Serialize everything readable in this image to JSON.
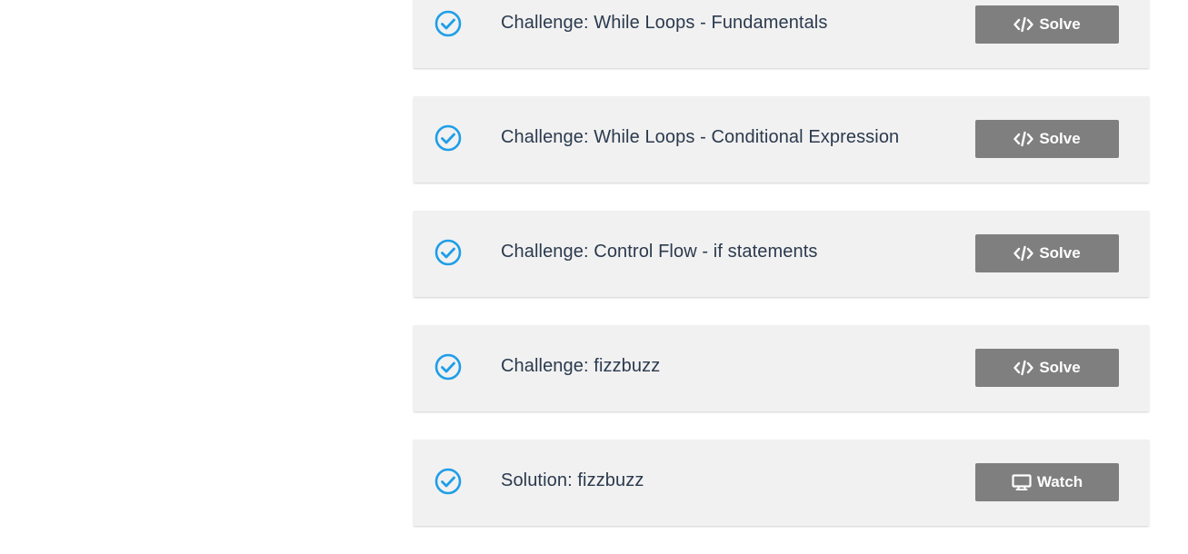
{
  "lessons": [
    {
      "title": "Challenge: While Loops - Fundamentals",
      "status_icon": "check-circle-icon",
      "action_label": "Solve",
      "action_icon": "code-icon"
    },
    {
      "title": "Challenge: While Loops - Conditional Expression",
      "status_icon": "check-circle-icon",
      "action_label": "Solve",
      "action_icon": "code-icon"
    },
    {
      "title": "Challenge: Control Flow - if statements",
      "status_icon": "check-circle-icon",
      "action_label": "Solve",
      "action_icon": "code-icon"
    },
    {
      "title": "Challenge: fizzbuzz",
      "status_icon": "check-circle-icon",
      "action_label": "Solve",
      "action_icon": "code-icon"
    },
    {
      "title": "Solution: fizzbuzz",
      "status_icon": "check-circle-icon",
      "action_label": "Watch",
      "action_icon": "monitor-icon"
    }
  ],
  "colors": {
    "check": "#1e9ee8",
    "card_bg": "#f1f1f1",
    "button_bg": "#7f7f80",
    "title_text": "#2b3a4e"
  }
}
